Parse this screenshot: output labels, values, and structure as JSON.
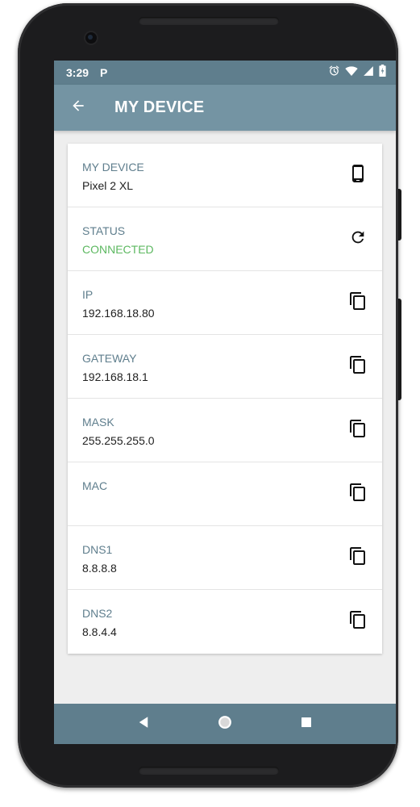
{
  "status_bar": {
    "time": "3:29",
    "app_indicator": "P",
    "icons": [
      "alarm-icon",
      "wifi-icon",
      "signal-icon",
      "battery-icon"
    ]
  },
  "app_bar": {
    "title": "MY DEVICE",
    "back_icon": "arrow-back-icon"
  },
  "rows": [
    {
      "label": "MY DEVICE",
      "value": "Pixel 2 XL",
      "action_icon": "smartphone-icon"
    },
    {
      "label": "STATUS",
      "value": "CONNECTED",
      "action_icon": "refresh-icon"
    },
    {
      "label": "IP",
      "value": "192.168.18.80",
      "action_icon": "copy-icon"
    },
    {
      "label": "GATEWAY",
      "value": "192.168.18.1",
      "action_icon": "copy-icon"
    },
    {
      "label": "MASK",
      "value": "255.255.255.0",
      "action_icon": "copy-icon"
    },
    {
      "label": "MAC",
      "value": "",
      "action_icon": "copy-icon"
    },
    {
      "label": "DNS1",
      "value": "8.8.8.8",
      "action_icon": "copy-icon"
    },
    {
      "label": "DNS2",
      "value": "8.8.4.4",
      "action_icon": "copy-icon"
    }
  ],
  "nav_bar": {
    "icons": [
      "nav-back-icon",
      "nav-home-icon",
      "nav-recents-icon"
    ]
  },
  "colors": {
    "status_bar": "#5f7e8d",
    "app_bar": "#7494a3",
    "label": "#5f7e8d",
    "connected": "#5cb860",
    "background": "#eeeeee"
  }
}
